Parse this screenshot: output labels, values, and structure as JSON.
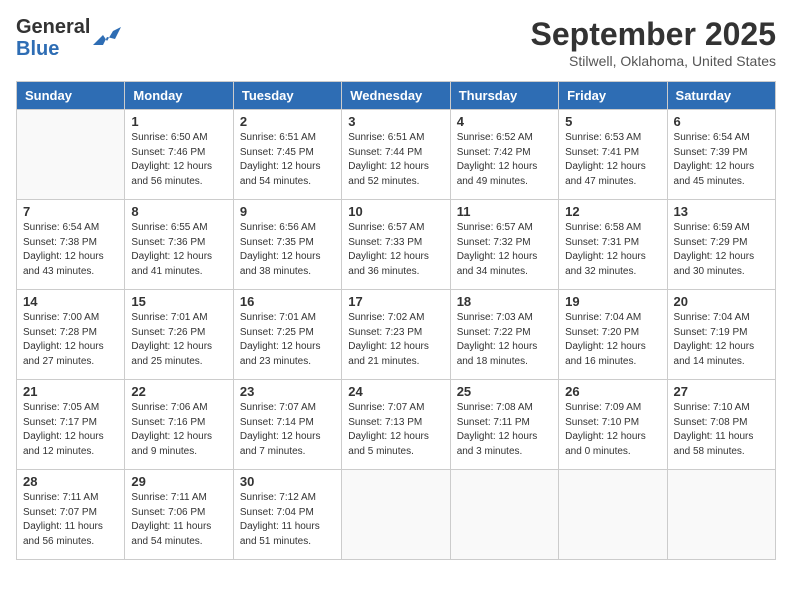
{
  "header": {
    "logo_general": "General",
    "logo_blue": "Blue",
    "month": "September 2025",
    "location": "Stilwell, Oklahoma, United States"
  },
  "days_of_week": [
    "Sunday",
    "Monday",
    "Tuesday",
    "Wednesday",
    "Thursday",
    "Friday",
    "Saturday"
  ],
  "weeks": [
    [
      {
        "day": "",
        "info": ""
      },
      {
        "day": "1",
        "info": "Sunrise: 6:50 AM\nSunset: 7:46 PM\nDaylight: 12 hours\nand 56 minutes."
      },
      {
        "day": "2",
        "info": "Sunrise: 6:51 AM\nSunset: 7:45 PM\nDaylight: 12 hours\nand 54 minutes."
      },
      {
        "day": "3",
        "info": "Sunrise: 6:51 AM\nSunset: 7:44 PM\nDaylight: 12 hours\nand 52 minutes."
      },
      {
        "day": "4",
        "info": "Sunrise: 6:52 AM\nSunset: 7:42 PM\nDaylight: 12 hours\nand 49 minutes."
      },
      {
        "day": "5",
        "info": "Sunrise: 6:53 AM\nSunset: 7:41 PM\nDaylight: 12 hours\nand 47 minutes."
      },
      {
        "day": "6",
        "info": "Sunrise: 6:54 AM\nSunset: 7:39 PM\nDaylight: 12 hours\nand 45 minutes."
      }
    ],
    [
      {
        "day": "7",
        "info": "Sunrise: 6:54 AM\nSunset: 7:38 PM\nDaylight: 12 hours\nand 43 minutes."
      },
      {
        "day": "8",
        "info": "Sunrise: 6:55 AM\nSunset: 7:36 PM\nDaylight: 12 hours\nand 41 minutes."
      },
      {
        "day": "9",
        "info": "Sunrise: 6:56 AM\nSunset: 7:35 PM\nDaylight: 12 hours\nand 38 minutes."
      },
      {
        "day": "10",
        "info": "Sunrise: 6:57 AM\nSunset: 7:33 PM\nDaylight: 12 hours\nand 36 minutes."
      },
      {
        "day": "11",
        "info": "Sunrise: 6:57 AM\nSunset: 7:32 PM\nDaylight: 12 hours\nand 34 minutes."
      },
      {
        "day": "12",
        "info": "Sunrise: 6:58 AM\nSunset: 7:31 PM\nDaylight: 12 hours\nand 32 minutes."
      },
      {
        "day": "13",
        "info": "Sunrise: 6:59 AM\nSunset: 7:29 PM\nDaylight: 12 hours\nand 30 minutes."
      }
    ],
    [
      {
        "day": "14",
        "info": "Sunrise: 7:00 AM\nSunset: 7:28 PM\nDaylight: 12 hours\nand 27 minutes."
      },
      {
        "day": "15",
        "info": "Sunrise: 7:01 AM\nSunset: 7:26 PM\nDaylight: 12 hours\nand 25 minutes."
      },
      {
        "day": "16",
        "info": "Sunrise: 7:01 AM\nSunset: 7:25 PM\nDaylight: 12 hours\nand 23 minutes."
      },
      {
        "day": "17",
        "info": "Sunrise: 7:02 AM\nSunset: 7:23 PM\nDaylight: 12 hours\nand 21 minutes."
      },
      {
        "day": "18",
        "info": "Sunrise: 7:03 AM\nSunset: 7:22 PM\nDaylight: 12 hours\nand 18 minutes."
      },
      {
        "day": "19",
        "info": "Sunrise: 7:04 AM\nSunset: 7:20 PM\nDaylight: 12 hours\nand 16 minutes."
      },
      {
        "day": "20",
        "info": "Sunrise: 7:04 AM\nSunset: 7:19 PM\nDaylight: 12 hours\nand 14 minutes."
      }
    ],
    [
      {
        "day": "21",
        "info": "Sunrise: 7:05 AM\nSunset: 7:17 PM\nDaylight: 12 hours\nand 12 minutes."
      },
      {
        "day": "22",
        "info": "Sunrise: 7:06 AM\nSunset: 7:16 PM\nDaylight: 12 hours\nand 9 minutes."
      },
      {
        "day": "23",
        "info": "Sunrise: 7:07 AM\nSunset: 7:14 PM\nDaylight: 12 hours\nand 7 minutes."
      },
      {
        "day": "24",
        "info": "Sunrise: 7:07 AM\nSunset: 7:13 PM\nDaylight: 12 hours\nand 5 minutes."
      },
      {
        "day": "25",
        "info": "Sunrise: 7:08 AM\nSunset: 7:11 PM\nDaylight: 12 hours\nand 3 minutes."
      },
      {
        "day": "26",
        "info": "Sunrise: 7:09 AM\nSunset: 7:10 PM\nDaylight: 12 hours\nand 0 minutes."
      },
      {
        "day": "27",
        "info": "Sunrise: 7:10 AM\nSunset: 7:08 PM\nDaylight: 11 hours\nand 58 minutes."
      }
    ],
    [
      {
        "day": "28",
        "info": "Sunrise: 7:11 AM\nSunset: 7:07 PM\nDaylight: 11 hours\nand 56 minutes."
      },
      {
        "day": "29",
        "info": "Sunrise: 7:11 AM\nSunset: 7:06 PM\nDaylight: 11 hours\nand 54 minutes."
      },
      {
        "day": "30",
        "info": "Sunrise: 7:12 AM\nSunset: 7:04 PM\nDaylight: 11 hours\nand 51 minutes."
      },
      {
        "day": "",
        "info": ""
      },
      {
        "day": "",
        "info": ""
      },
      {
        "day": "",
        "info": ""
      },
      {
        "day": "",
        "info": ""
      }
    ]
  ]
}
